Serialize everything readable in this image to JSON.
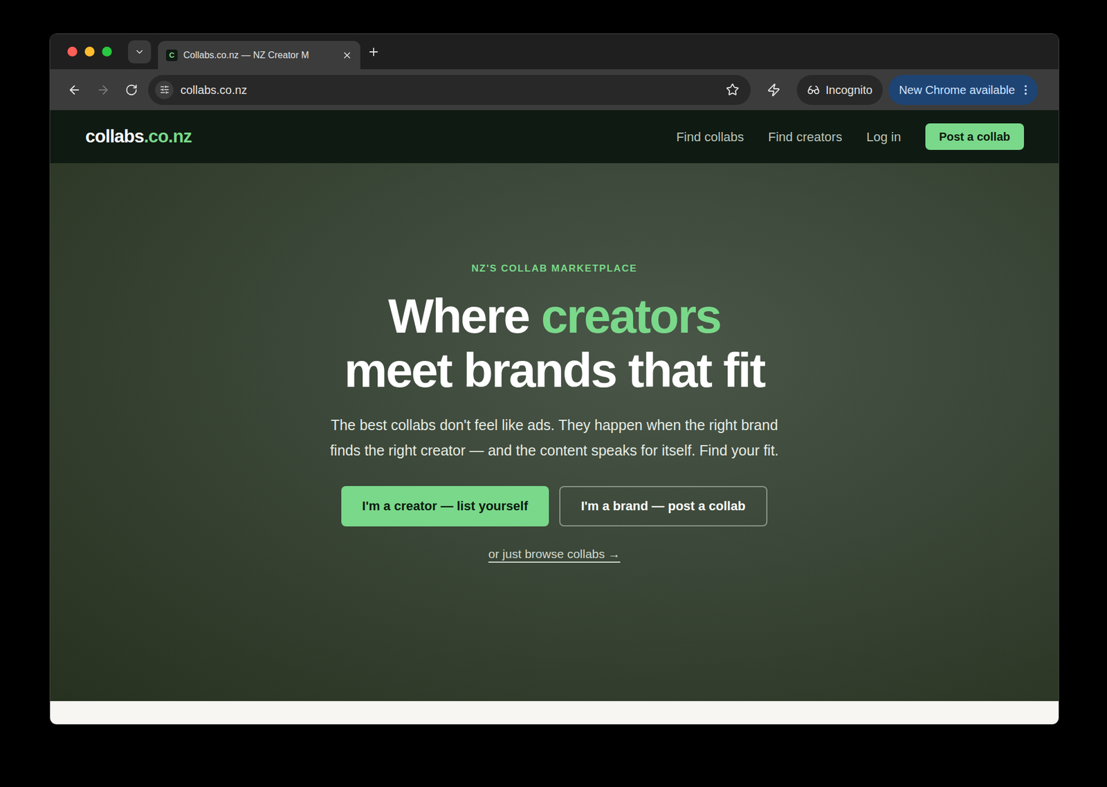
{
  "browser": {
    "tab": {
      "favicon": "C",
      "title": "Collabs.co.nz — NZ Creator M",
      "selected": true
    },
    "url": "collabs.co.nz",
    "incognito": "Incognito",
    "update": "New Chrome available",
    "forward_disabled": true
  },
  "nav": {
    "logo": {
      "name": "collabs",
      "suffix": ".co.nz"
    },
    "links": [
      "Find collabs",
      "Find creators",
      "Log in"
    ],
    "cta": "Post a collab"
  },
  "hero": {
    "eyebrow": "NZ'S COLLAB MARKETPLACE",
    "heading": [
      [
        {
          "text": "Where",
          "highlight": false
        },
        {
          "text": "creators",
          "highlight": true
        }
      ],
      [
        {
          "text": "meet brands that fit",
          "highlight": false
        }
      ]
    ],
    "body": "The best collabs don't feel like ads. They happen when the right brand finds the right creator — and the content speaks for itself. Find your fit.",
    "buttons": [
      {
        "label": "I'm a creator — list yourself",
        "kind": "primary"
      },
      {
        "label": "I'm a brand — post a collab",
        "kind": "outline"
      }
    ],
    "browse_link": "or just browse collabs →"
  }
}
